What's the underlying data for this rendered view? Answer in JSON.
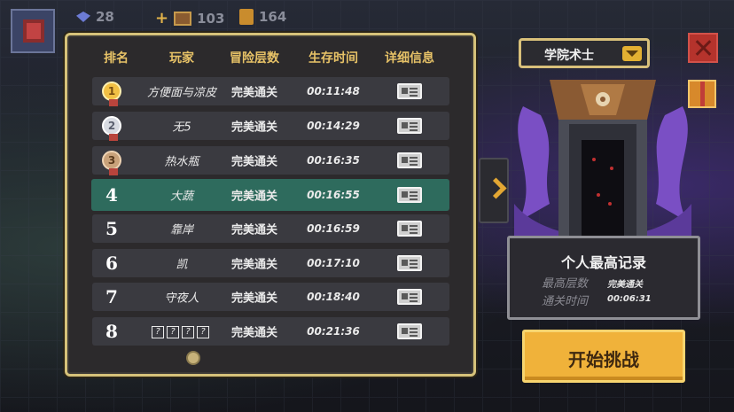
{
  "top_bar": {
    "stats": [
      {
        "icon": "gem-icon",
        "value": "28"
      },
      {
        "icon": "chest-icon",
        "value": "103"
      },
      {
        "icon": "coin-icon",
        "value": "164"
      }
    ]
  },
  "leaderboard": {
    "headers": [
      "排名",
      "玩家",
      "冒险层数",
      "生存时间",
      "详细信息"
    ],
    "rows": [
      {
        "rank": "1",
        "player": "方便面与凉皮",
        "floors": "完美通关",
        "time": "00:11:48",
        "medal": "gold"
      },
      {
        "rank": "2",
        "player": "无5",
        "floors": "完美通关",
        "time": "00:14:29",
        "medal": "silver"
      },
      {
        "rank": "3",
        "player": "热水瓶",
        "floors": "完美通关",
        "time": "00:16:35",
        "medal": "bronze"
      },
      {
        "rank": "4",
        "player": "大蔬",
        "floors": "完美通关",
        "time": "00:16:55",
        "highlighted": true
      },
      {
        "rank": "5",
        "player": "靠岸",
        "floors": "完美通关",
        "time": "00:16:59"
      },
      {
        "rank": "6",
        "player": "凯",
        "floors": "完美通关",
        "time": "00:17:10"
      },
      {
        "rank": "7",
        "player": "守夜人",
        "floors": "完美通关",
        "time": "00:18:40"
      },
      {
        "rank": "8",
        "player": "????",
        "floors": "完美通关",
        "time": "00:21:36"
      }
    ]
  },
  "class_selector": {
    "selected": "学院术士"
  },
  "personal_record": {
    "title": "个人最高记录",
    "floors_label": "最高层数",
    "floors_value": "完美通关",
    "time_label": "通关时间",
    "time_value": "00:06:31"
  },
  "start_button": {
    "label": "开始挑战"
  },
  "colors": {
    "panel_border": "#d6c27a",
    "header_text": "#e7c267",
    "highlight_row": "#2e6b5d",
    "start_button": "#f0b23a"
  }
}
